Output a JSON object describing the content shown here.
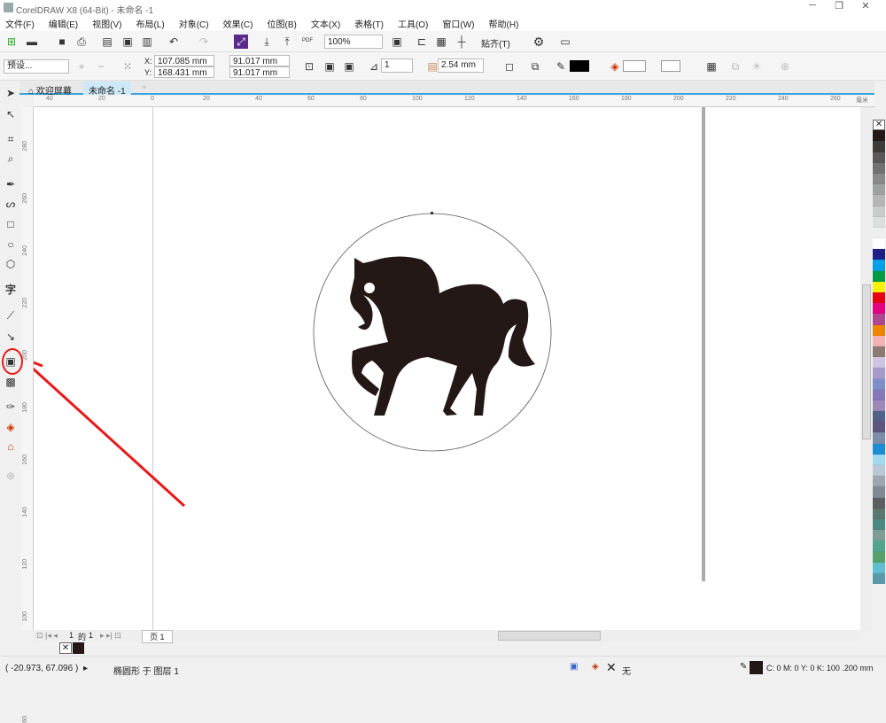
{
  "window": {
    "title": "CorelDRAW X8 (64-Bit) - 未命名 -1",
    "min": "─",
    "restore": "❐",
    "close": "✕"
  },
  "menu": [
    "文件(F)",
    "编辑(E)",
    "视图(V)",
    "布局(L)",
    "对象(C)",
    "效果(C)",
    "位图(B)",
    "文本(X)",
    "表格(T)",
    "工具(O)",
    "窗口(W)",
    "帮助(H)"
  ],
  "toolbar": {
    "zoom": "100%",
    "snap": "贴齐(T)",
    "pdf": "PDF"
  },
  "propbar": {
    "preset": "预设...",
    "x": "107.085 mm",
    "y": "168.431 mm",
    "w": "91.017 mm",
    "h": "91.017 mm",
    "x_label": "X:",
    "y_label": "Y:",
    "outline_count": "1",
    "offset": "2.54 mm"
  },
  "tabs": [
    {
      "label": "欢迎屏幕"
    },
    {
      "label": "未命名 -1"
    }
  ],
  "ruler": {
    "h_ticks": [
      "40",
      "20",
      "0",
      "20",
      "40",
      "60",
      "80",
      "100",
      "120",
      "140",
      "160",
      "180",
      "200",
      "220",
      "240",
      "260"
    ],
    "unit": "毫米",
    "v_ticks": [
      "280",
      "260",
      "240",
      "220",
      "200",
      "180",
      "160",
      "140",
      "120",
      "100",
      "80",
      "60"
    ]
  },
  "page_nav": {
    "current": "1",
    "of": "的",
    "total": "1",
    "page_tab": "页 1"
  },
  "status": {
    "coords": "( -20.973, 67.096 )",
    "object": "椭圆形 于 图层 1",
    "fill": "无",
    "outline": "C: 0 M: 0 Y: 0 K: 100  .200 mm"
  },
  "colors": {
    "accent": "#3aa4db",
    "annotation": "#e8191a",
    "shape": "#231815"
  },
  "palette": [
    "#231815",
    "#3e3a39",
    "#595757",
    "#727171",
    "#898989",
    "#9fa0a0",
    "#b5b5b6",
    "#c9caca",
    "#dcdddd",
    "#efefef",
    "#ffffff",
    "#1d2088",
    "#00a0e9",
    "#009944",
    "#fff100",
    "#e60012",
    "#e4007f",
    "#b14793",
    "#f08300",
    "#f5b2b2",
    "#8c7b72",
    "#d0c5e0",
    "#a59aca",
    "#7d8ec8",
    "#8578b8",
    "#9c89b8",
    "#51628a",
    "#5d5780",
    "#7c8da7",
    "#1b8dd6",
    "#a0d8ef",
    "#b8c8d4",
    "#9ea7ad",
    "#7f8a91",
    "#595f63",
    "#5c7670",
    "#4b8a7f",
    "#7e9c96",
    "#4fa58e",
    "#56a06a",
    "#5fbfd1",
    "#5a9aaa"
  ]
}
